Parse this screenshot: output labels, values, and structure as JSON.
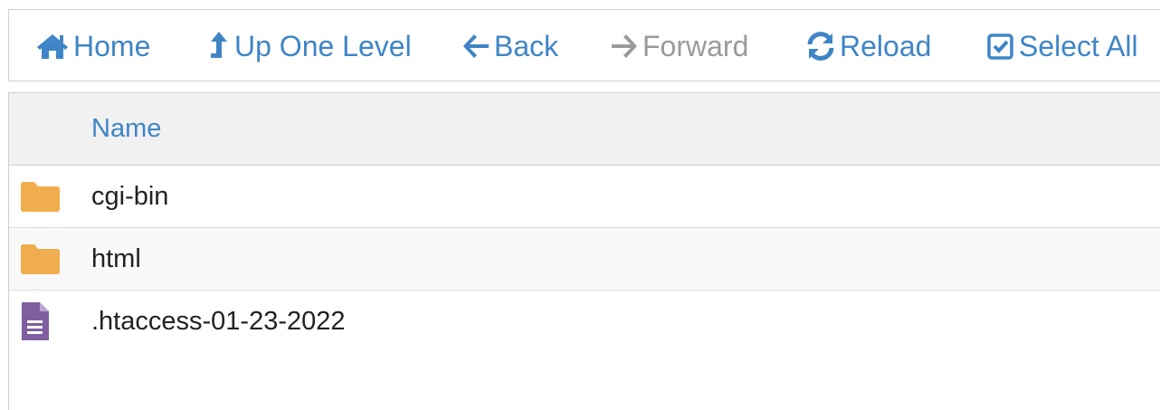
{
  "toolbar": {
    "home_label": "Home",
    "up_label": "Up One Level",
    "back_label": "Back",
    "forward_label": "Forward",
    "reload_label": "Reload",
    "select_all_label": "Select All"
  },
  "table": {
    "column_name": "Name",
    "rows": [
      {
        "name": "cgi-bin",
        "type": "folder-icon"
      },
      {
        "name": "html",
        "type": "folder-icon"
      },
      {
        "name": ".htaccess-01-23-2022",
        "type": "file-icon"
      }
    ]
  },
  "colors": {
    "accent": "#3f85c6",
    "disabled": "#9a9a9a",
    "folder": "#f0ad4e",
    "file": "#7f5fa0"
  }
}
